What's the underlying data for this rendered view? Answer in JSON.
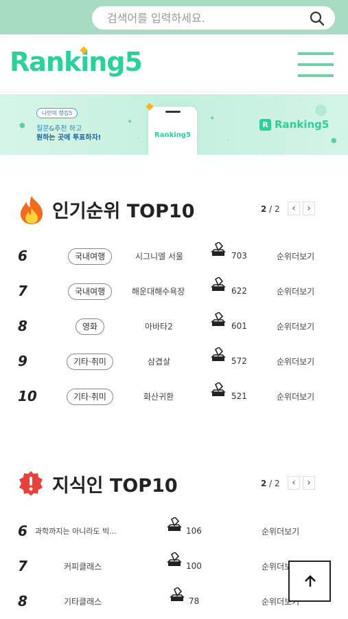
{
  "search": {
    "placeholder": "검색어를 입력하세요."
  },
  "logo": {
    "text": "Ranking5"
  },
  "banner": {
    "pill": "나만의 랭킹5",
    "line1": "질문&추천 하고",
    "line2": "원하는 곳에 투표하자!",
    "phone_text": "Ranking5",
    "brand": "Ranking5",
    "brand_icon": "R"
  },
  "popular": {
    "title": "인기순위 TOP10",
    "page_current": "2",
    "page_sep": " / ",
    "page_total": "2",
    "items": [
      {
        "rank": "6",
        "category": "국내여행",
        "name": "시그니엘 서울",
        "votes": "703",
        "more": "순위더보기"
      },
      {
        "rank": "7",
        "category": "국내여행",
        "name": "해운대해수욕장",
        "votes": "622",
        "more": "순위더보기"
      },
      {
        "rank": "8",
        "category": "영화",
        "name": "아바타2",
        "votes": "601",
        "more": "순위더보기"
      },
      {
        "rank": "9",
        "category": "기타·취미",
        "name": "삼겹살",
        "votes": "572",
        "more": "순위더보기"
      },
      {
        "rank": "10",
        "category": "기타·취미",
        "name": "화산귀환",
        "votes": "521",
        "more": "순위더보기"
      }
    ]
  },
  "knowledge": {
    "title": "지식인 TOP10",
    "page_current": "2",
    "page_sep": " / ",
    "page_total": "2",
    "items": [
      {
        "rank": "6",
        "name": "과학까지는 아니라도 빅...",
        "votes": "106",
        "more": "순위더보기"
      },
      {
        "rank": "7",
        "name": "커피클래스",
        "votes": "100",
        "more": "순위더보기"
      },
      {
        "rank": "8",
        "name": "기타클래스",
        "votes": "78",
        "more": "순위더보기"
      }
    ]
  },
  "icons": {
    "search": "search-icon",
    "menu": "hamburger-menu-icon",
    "fire": "fire-icon",
    "alert": "alert-badge-icon",
    "vote": "vote-box-icon",
    "prev": "chevron-left-icon",
    "next": "chevron-right-icon",
    "top": "arrow-up-icon"
  },
  "colors": {
    "brand": "#2dcf9a",
    "topbar": "#a8dcc2",
    "accent_star": "#f7b81e"
  }
}
